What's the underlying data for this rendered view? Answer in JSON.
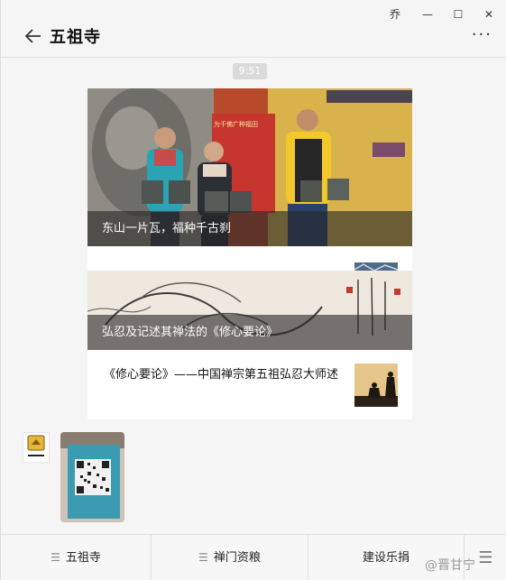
{
  "window": {
    "title": "五祖寺",
    "controls": {
      "pin_icon": "pin-icon",
      "pin_glyph": "乔",
      "minimize_glyph": "—",
      "maximize_glyph": "☐",
      "close_glyph": "✕"
    },
    "more_glyph": "···"
  },
  "chat": {
    "timestamp": "9:51",
    "article_card": {
      "main_title": "东山一片瓦，福种千古刹",
      "second_title": "弘忍及记述其禅法的《修心要论》",
      "third_title": "《修心要论》——中国禅宗第五祖弘忍大师述",
      "hero_sign_text": "为千佛广种福田"
    },
    "avatar_text": "五祖寺"
  },
  "menu": {
    "items": [
      {
        "label": "五祖寺",
        "has_menu_icon": true
      },
      {
        "label": "禅门资粮",
        "has_menu_icon": true
      },
      {
        "label": "建设乐捐",
        "has_menu_icon": false
      }
    ],
    "ham_glyph": "☰"
  },
  "watermark": "@晋甘宁",
  "colors": {
    "window_bg": "#f5f5f5",
    "caption_bg": "rgba(40,40,40,0.62)",
    "time_pill": "#dadada"
  }
}
